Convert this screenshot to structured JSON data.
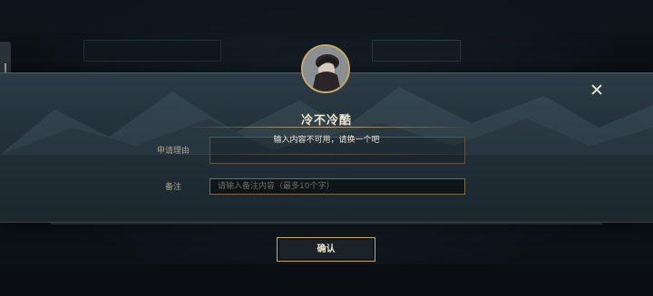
{
  "modal": {
    "title": "冷不冷酷",
    "close_icon": "close-icon",
    "avatar_icon": "player-avatar",
    "reason": {
      "label": "申请理由",
      "error_message": "输入内容不可用，请换一个吧"
    },
    "remark": {
      "label": "备注",
      "value": "",
      "placeholder": "请输入备注内容（最多10个字）"
    },
    "confirm_label": "确认"
  },
  "colors": {
    "accent_gold": "#c8aa6e",
    "title_text": "#f0e6d2",
    "panel_top": "#2c3c46",
    "page_bg": "#0b1014"
  }
}
